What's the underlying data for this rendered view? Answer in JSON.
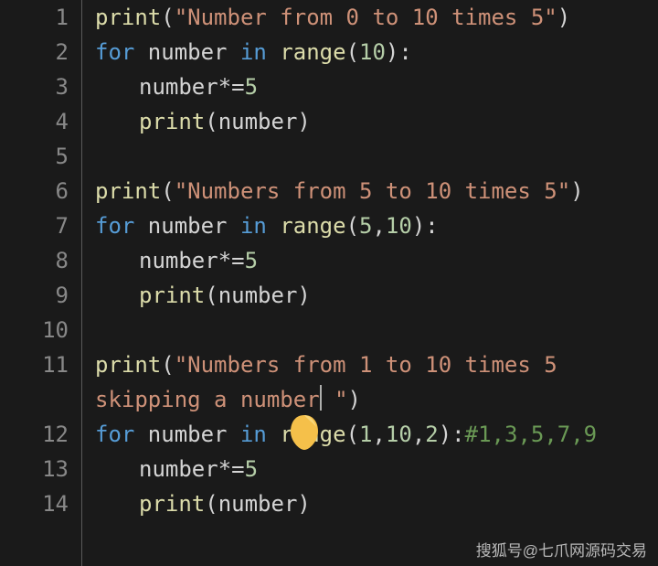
{
  "code": {
    "lines": [
      {
        "n": 1,
        "tokens": [
          {
            "t": "print",
            "c": "tok-fn"
          },
          {
            "t": "(",
            "c": "tok-punc"
          },
          {
            "t": "\"Number from 0 to 10 times 5\"",
            "c": "tok-str"
          },
          {
            "t": ")",
            "c": "tok-punc"
          }
        ]
      },
      {
        "n": 2,
        "tokens": [
          {
            "t": "for ",
            "c": "tok-kw"
          },
          {
            "t": "number ",
            "c": "tok-id"
          },
          {
            "t": "in ",
            "c": "tok-kw"
          },
          {
            "t": "range",
            "c": "tok-fn"
          },
          {
            "t": "(",
            "c": "tok-punc"
          },
          {
            "t": "10",
            "c": "tok-num"
          },
          {
            "t": "):",
            "c": "tok-punc"
          }
        ]
      },
      {
        "n": 3,
        "indent": true,
        "tokens": [
          {
            "t": "number",
            "c": "tok-id"
          },
          {
            "t": "*=",
            "c": "tok-punc"
          },
          {
            "t": "5",
            "c": "tok-num"
          }
        ]
      },
      {
        "n": 4,
        "indent": true,
        "tokens": [
          {
            "t": "print",
            "c": "tok-fn"
          },
          {
            "t": "(",
            "c": "tok-punc"
          },
          {
            "t": "number",
            "c": "tok-id"
          },
          {
            "t": ")",
            "c": "tok-punc"
          }
        ]
      },
      {
        "n": 5,
        "tokens": []
      },
      {
        "n": 6,
        "tokens": [
          {
            "t": "print",
            "c": "tok-fn"
          },
          {
            "t": "(",
            "c": "tok-punc"
          },
          {
            "t": "\"Numbers from 5 to 10 times 5\"",
            "c": "tok-str"
          },
          {
            "t": ")",
            "c": "tok-punc"
          }
        ]
      },
      {
        "n": 7,
        "tokens": [
          {
            "t": "for ",
            "c": "tok-kw"
          },
          {
            "t": "number ",
            "c": "tok-id"
          },
          {
            "t": "in ",
            "c": "tok-kw"
          },
          {
            "t": "range",
            "c": "tok-fn"
          },
          {
            "t": "(",
            "c": "tok-punc"
          },
          {
            "t": "5",
            "c": "tok-num"
          },
          {
            "t": ",",
            "c": "tok-punc"
          },
          {
            "t": "10",
            "c": "tok-num"
          },
          {
            "t": "):",
            "c": "tok-punc"
          }
        ]
      },
      {
        "n": 8,
        "indent": true,
        "tokens": [
          {
            "t": "number",
            "c": "tok-id"
          },
          {
            "t": "*=",
            "c": "tok-punc"
          },
          {
            "t": "5",
            "c": "tok-num"
          }
        ]
      },
      {
        "n": 9,
        "indent": true,
        "tokens": [
          {
            "t": "print",
            "c": "tok-fn"
          },
          {
            "t": "(",
            "c": "tok-punc"
          },
          {
            "t": "number",
            "c": "tok-id"
          },
          {
            "t": ")",
            "c": "tok-punc"
          }
        ]
      },
      {
        "n": 10,
        "tokens": []
      },
      {
        "n": 11,
        "wrap": true,
        "tokensA": [
          {
            "t": "print",
            "c": "tok-fn"
          },
          {
            "t": "(",
            "c": "tok-punc"
          },
          {
            "t": "\"Numbers from 1 to 10 times 5 ",
            "c": "tok-str"
          }
        ],
        "tokensB": [
          {
            "t": "skipping a number",
            "c": "tok-str"
          },
          {
            "t": "__CARET__",
            "c": ""
          },
          {
            "t": " \"",
            "c": "tok-str"
          },
          {
            "t": ")",
            "c": "tok-punc"
          }
        ]
      },
      {
        "n": 12,
        "tokens": [
          {
            "t": "for ",
            "c": "tok-kw"
          },
          {
            "t": "number ",
            "c": "tok-id"
          },
          {
            "t": "in ",
            "c": "tok-kw"
          },
          {
            "t": "range",
            "c": "tok-fn"
          },
          {
            "t": "(",
            "c": "tok-punc"
          },
          {
            "t": "1",
            "c": "tok-num"
          },
          {
            "t": ",",
            "c": "tok-punc"
          },
          {
            "t": "10",
            "c": "tok-num"
          },
          {
            "t": ",",
            "c": "tok-punc"
          },
          {
            "t": "2",
            "c": "tok-num"
          },
          {
            "t": "):",
            "c": "tok-punc"
          },
          {
            "t": "#1,3,5,7,9",
            "c": "tok-cmt"
          }
        ]
      },
      {
        "n": 13,
        "indent": true,
        "tokens": [
          {
            "t": "number",
            "c": "tok-id"
          },
          {
            "t": "*=",
            "c": "tok-punc"
          },
          {
            "t": "5",
            "c": "tok-num"
          }
        ]
      },
      {
        "n": 14,
        "indent": true,
        "tokens": [
          {
            "t": "print",
            "c": "tok-fn"
          },
          {
            "t": "(",
            "c": "tok-punc"
          },
          {
            "t": "number",
            "c": "tok-id"
          },
          {
            "t": ")",
            "c": "tok-punc"
          }
        ]
      }
    ]
  },
  "watermark": "搜狐号@七爪网源码交易"
}
